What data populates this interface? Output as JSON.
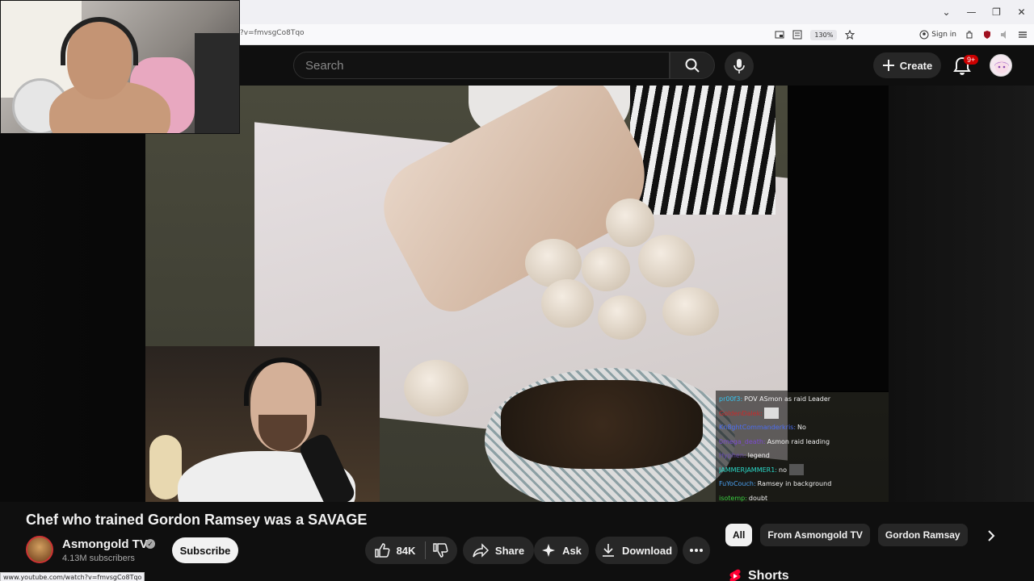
{
  "browser": {
    "url_fragment": "?v=fmvsgCo8Tqo",
    "zoom": "130%",
    "sign_in": "Sign in",
    "status_url": "www.youtube.com/watch?v=fmvsgCo8Tqo"
  },
  "masthead": {
    "search_placeholder": "Search",
    "create_label": "Create",
    "notification_count": "9+"
  },
  "chat": [
    {
      "name": "pr00f3:",
      "color": "#35c4f0",
      "msg": "POV ASmon as raid Leader"
    },
    {
      "name": "GoldenDalek:",
      "color": "#c92a2a",
      "msg": ""
    },
    {
      "name": "Kn8ghtCommanderkris:",
      "color": "#4b6cf0",
      "msg": "No"
    },
    {
      "name": "0mega_death:",
      "color": "#7b4bd0",
      "msg": "Asmon raid leading"
    },
    {
      "name": "Hyphen:",
      "color": "#6a4ab0",
      "msg": "legend"
    },
    {
      "name": "JAMMERJAMMER1:",
      "color": "#2ad8c8",
      "msg": "no"
    },
    {
      "name": "FuYoCouch:",
      "color": "#4aa0f0",
      "msg": "Ramsey in background"
    },
    {
      "name": "isotemp:",
      "color": "#3ad040",
      "msg": "doubt"
    }
  ],
  "video": {
    "title": "Chef who trained Gordon Ramsey was a SAVAGE",
    "channel": "Asmongold TV",
    "subscribers": "4.13M subscribers",
    "subscribe_label": "Subscribe",
    "likes": "84K",
    "share_label": "Share",
    "ask_label": "Ask",
    "download_label": "Download"
  },
  "chips": [
    "All",
    "From Asmongold TV",
    "Gordon Ramsay"
  ],
  "shorts_label": "Shorts",
  "colors": {
    "accent_red": "#ff0033",
    "background": "#0f0f0f",
    "pill": "#272727"
  }
}
